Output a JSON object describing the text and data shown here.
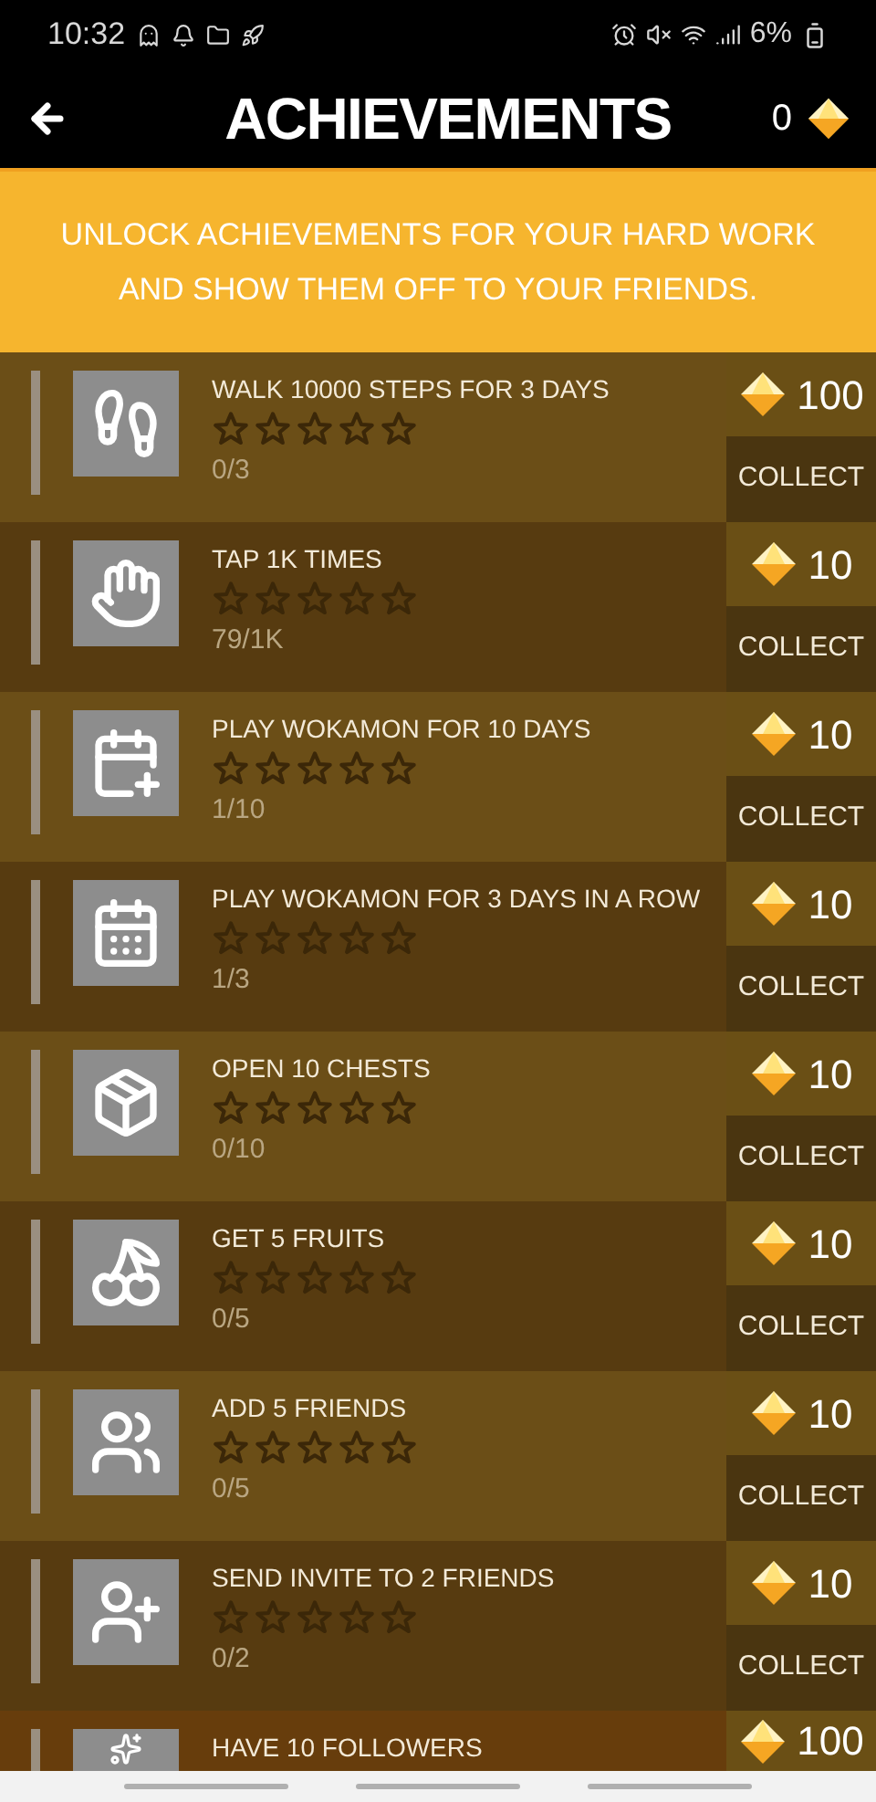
{
  "status_bar": {
    "time": "10:32",
    "battery": "6%"
  },
  "header": {
    "title": "ACHIEVEMENTS",
    "gems": "0"
  },
  "banner": "UNLOCK ACHIEVEMENTS FOR YOUR HARD WORK AND SHOW THEM OFF TO YOUR FRIENDS.",
  "achievements": [
    {
      "title": "WALK 10000 STEPS FOR 3 DAYS",
      "stars": 0,
      "progress": "0/3",
      "reward": "100",
      "action": "COLLECT"
    },
    {
      "title": "TAP 1K TIMES",
      "stars": 0,
      "progress": "79/1K",
      "reward": "10",
      "action": "COLLECT"
    },
    {
      "title": "PLAY WOKAMON FOR 10 DAYS",
      "stars": 0,
      "progress": "1/10",
      "reward": "10",
      "action": "COLLECT"
    },
    {
      "title": "PLAY WOKAMON FOR 3 DAYS IN A ROW",
      "stars": 0,
      "progress": "1/3",
      "reward": "10",
      "action": "COLLECT"
    },
    {
      "title": "OPEN 10 CHESTS",
      "stars": 0,
      "progress": "0/10",
      "reward": "10",
      "action": "COLLECT"
    },
    {
      "title": "GET 5 FRUITS",
      "stars": 0,
      "progress": "0/5",
      "reward": "10",
      "action": "COLLECT"
    },
    {
      "title": "ADD 5 FRIENDS",
      "stars": 0,
      "progress": "0/5",
      "reward": "10",
      "action": "COLLECT"
    },
    {
      "title": "SEND INVITE TO 2 FRIENDS",
      "stars": 0,
      "progress": "0/2",
      "reward": "10",
      "action": "COLLECT"
    },
    {
      "title": "HAVE 10 FOLLOWERS",
      "reward": "100"
    }
  ]
}
